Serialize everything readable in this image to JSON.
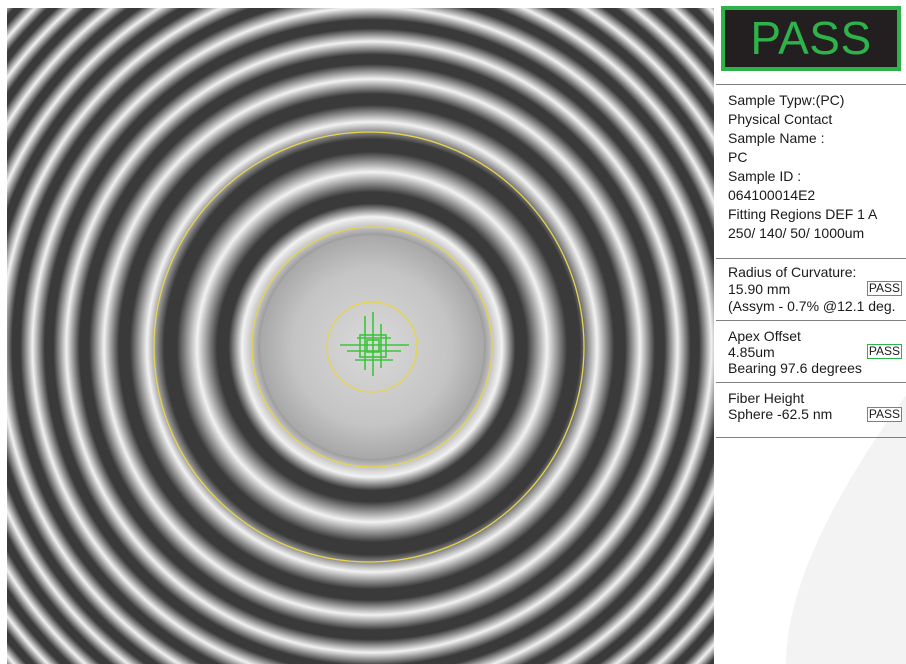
{
  "result": {
    "status": "PASS",
    "accent_color": "#2db34a",
    "box_color": "#231f20"
  },
  "sample": {
    "type_label": "Sample Typw:(PC)",
    "type_value": "Physical Contact",
    "name_label": "Sample Name :",
    "name_value": "PC",
    "id_label": "Sample ID :",
    "id_value": "064100014E2",
    "fitting_label": "Fitting Regions  DEF 1 A",
    "fitting_value": "250/ 140/ 50/ 1000um"
  },
  "radius_of_curvature": {
    "label": "Radius of Curvature:",
    "value": "15.90 mm",
    "assym": "(Assym - 0.7% @12.1 deg.",
    "status": "PASS"
  },
  "apex_offset": {
    "label": "Apex Offset",
    "value": "4.85um",
    "bearing": "Bearing 97.6 degrees",
    "status": "PASS"
  },
  "fiber_height": {
    "label": "Fiber Height",
    "value": "Sphere -62.5 nm",
    "status": "PASS"
  },
  "overlay": {
    "ring_color": "#e8d44a",
    "crosshair_color": "#3cc43c",
    "fringe_dark": "#3a3a3a",
    "fringe_light": "#f2f2f2"
  },
  "icons": {
    "crosshair": "crosshair-icon"
  }
}
